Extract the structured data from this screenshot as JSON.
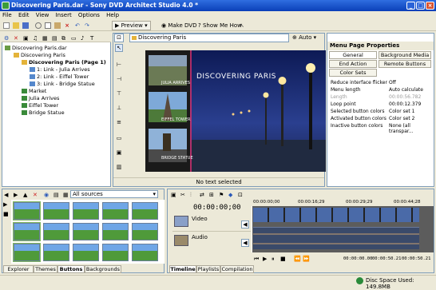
{
  "window": {
    "title": "Discovering Paris.dar - Sony DVD Architect Studio 4.0 *"
  },
  "menu": [
    "File",
    "Edit",
    "View",
    "Insert",
    "Options",
    "Help"
  ],
  "toolbar": {
    "preview": "Preview",
    "make_dvd": "Make DVD",
    "show_me_how": "Show Me How"
  },
  "tree": {
    "items": [
      {
        "label": "Discovering Paris.dar",
        "indent": 0,
        "bold": false
      },
      {
        "label": "Discovering Paris",
        "indent": 1,
        "bold": false
      },
      {
        "label": "Discovering Paris (Page 1)",
        "indent": 2,
        "bold": true
      },
      {
        "label": "1: Link - Julia Arrives",
        "indent": 3,
        "bold": false
      },
      {
        "label": "2: Link - Eiffel Tower",
        "indent": 3,
        "bold": false
      },
      {
        "label": "3: Link - Bridge Statue",
        "indent": 3,
        "bold": false
      },
      {
        "label": "Market",
        "indent": 1,
        "bold": false
      },
      {
        "label": "Julia Arrives",
        "indent": 1,
        "bold": false
      },
      {
        "label": "Eiffel Tower",
        "indent": 1,
        "bold": false
      },
      {
        "label": "Bridge Statue",
        "indent": 1,
        "bold": false
      }
    ]
  },
  "center": {
    "location": "Discovering Paris",
    "zoom": "Auto",
    "status": "No text selected",
    "menu_title": "DISCOVERING PARIS",
    "button_labels": [
      "JULIA ARRIVES",
      "EIFFEL TOWER",
      "BRIDGE STATUE"
    ]
  },
  "properties": {
    "header": "Menu Page Properties",
    "tabs": [
      "General",
      "Background Media",
      "End Action",
      "Remote Buttons",
      "Color Sets"
    ],
    "rows": [
      {
        "name": "Reduce interface flicker",
        "value": "Off",
        "disabled": false
      },
      {
        "name": "Menu length",
        "value": "Auto calculate",
        "disabled": false
      },
      {
        "name": "Length",
        "value": "00:00:56.782",
        "disabled": true
      },
      {
        "name": "Loop point",
        "value": "00:00:12.379",
        "disabled": false
      },
      {
        "name": "Selected button colors",
        "value": "Color set 1",
        "disabled": false
      },
      {
        "name": "Activated button colors",
        "value": "Color set 2",
        "disabled": false
      },
      {
        "name": "Inactive button colors",
        "value": "None (all transpar...",
        "disabled": false
      }
    ]
  },
  "media": {
    "filter": "All sources",
    "tabs": [
      "Explorer",
      "Themes",
      "Buttons",
      "Backgrounds"
    ],
    "active_tab": "Buttons"
  },
  "timeline": {
    "timecode": "00:00:00;00",
    "tracks": [
      "Video",
      "Audio"
    ],
    "ruler": [
      "00:00:00;00",
      "00:00:16;29",
      "00:00:29;29",
      "00:00:44;28"
    ],
    "tabs": [
      "Timeline",
      "Playlists",
      "Compilation"
    ],
    "active_tab": "Timeline",
    "pos_start": "00:00:00.00",
    "pos_end": "00:00:50.21",
    "pos_length": "00:00:50.21"
  },
  "status": {
    "disc_space": "Disc Space Used: 149.8MB"
  },
  "colors": {
    "accent": "#2f6ee0",
    "title_bar": "#0a3fb8",
    "menu_sep": "#e0306a"
  }
}
